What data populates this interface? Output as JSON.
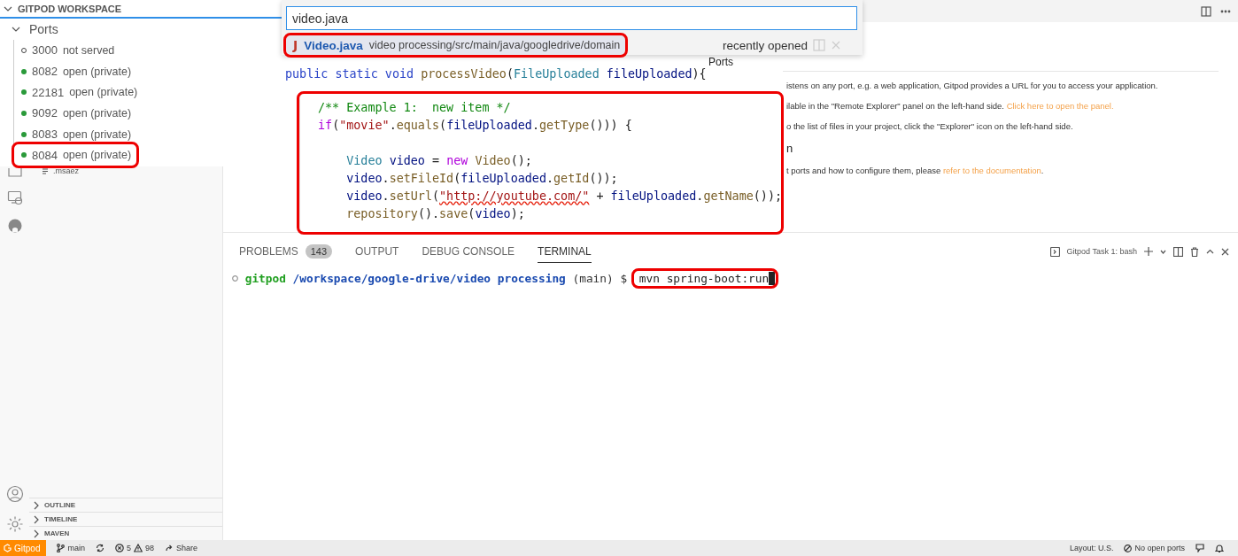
{
  "ports_panel": {
    "title": "GITPOD WORKSPACE",
    "section": "Ports",
    "expanded": true,
    "ports": [
      {
        "port": "3000",
        "status": "not served",
        "open": false,
        "highlighted": false
      },
      {
        "port": "8082",
        "status": "open (private)",
        "open": true,
        "highlighted": false
      },
      {
        "port": "22181",
        "status": "open (private)",
        "open": true,
        "highlighted": false
      },
      {
        "port": "9092",
        "status": "open (private)",
        "open": true,
        "highlighted": false
      },
      {
        "port": "8083",
        "status": "open (private)",
        "open": true,
        "highlighted": false
      },
      {
        "port": "8084",
        "status": "open (private)",
        "open": true,
        "highlighted": true
      }
    ]
  },
  "quick_open": {
    "value": "video.java",
    "results": [
      {
        "icon": "J",
        "name": "Video.java",
        "path": "video processing/src/main/java/googledrive/domain",
        "label": "recently opened",
        "selected": true,
        "highlighted": true
      }
    ]
  },
  "code_peek": {
    "signature": [
      {
        "kind": "keyword",
        "text": "public static void "
      },
      {
        "kind": "function",
        "text": "processVideo"
      },
      {
        "kind": "plain",
        "text": "("
      },
      {
        "kind": "type",
        "text": "FileUploaded "
      },
      {
        "kind": "variable",
        "text": "fileUploaded"
      },
      {
        "kind": "plain",
        "text": "){"
      }
    ],
    "block": {
      "highlighted": true,
      "groups": [
        {
          "lines": [
            [
              {
                "kind": "comment",
                "text": "/** Example 1:  new item */"
              }
            ],
            [
              {
                "kind": "control",
                "text": "if"
              },
              {
                "kind": "plain",
                "text": "("
              },
              {
                "kind": "string",
                "text": "\"movie\""
              },
              {
                "kind": "plain",
                "text": "."
              },
              {
                "kind": "function",
                "text": "equals"
              },
              {
                "kind": "plain",
                "text": "("
              },
              {
                "kind": "variable",
                "text": "fileUploaded"
              },
              {
                "kind": "plain",
                "text": "."
              },
              {
                "kind": "function",
                "text": "getType"
              },
              {
                "kind": "plain",
                "text": "())) {"
              }
            ]
          ]
        },
        {
          "lines": [
            [
              {
                "kind": "type",
                "text": "    Video "
              },
              {
                "kind": "variable",
                "text": "video"
              },
              {
                "kind": "plain",
                "text": " = "
              },
              {
                "kind": "control",
                "text": "new "
              },
              {
                "kind": "function",
                "text": "Video"
              },
              {
                "kind": "plain",
                "text": "();"
              }
            ],
            [
              {
                "kind": "variable",
                "text": "    video"
              },
              {
                "kind": "plain",
                "text": "."
              },
              {
                "kind": "function",
                "text": "setFileId"
              },
              {
                "kind": "plain",
                "text": "("
              },
              {
                "kind": "variable",
                "text": "fileUploaded"
              },
              {
                "kind": "plain",
                "text": "."
              },
              {
                "kind": "function",
                "text": "getId"
              },
              {
                "kind": "plain",
                "text": "());"
              }
            ],
            [
              {
                "kind": "variable",
                "text": "    video"
              },
              {
                "kind": "plain",
                "text": "."
              },
              {
                "kind": "function",
                "text": "setUrl"
              },
              {
                "kind": "plain",
                "text": "("
              },
              {
                "kind": "error_string",
                "text": "\"http://youtube.com/\""
              },
              {
                "kind": "plain",
                "text": " + "
              },
              {
                "kind": "variable",
                "text": "fileUploaded"
              },
              {
                "kind": "plain",
                "text": "."
              },
              {
                "kind": "function",
                "text": "getName"
              },
              {
                "kind": "plain",
                "text": "());"
              }
            ],
            [
              {
                "kind": "function",
                "text": "    repository"
              },
              {
                "kind": "plain",
                "text": "()."
              },
              {
                "kind": "function",
                "text": "save"
              },
              {
                "kind": "plain",
                "text": "("
              },
              {
                "kind": "variable",
                "text": "video"
              },
              {
                "kind": "plain",
                "text": ");"
              }
            ]
          ]
        }
      ]
    }
  },
  "editor": {
    "title": "Ports",
    "blocks": [
      {
        "kind": "paragraph",
        "text": "istens on any port, e.g. a web application, Gitpod provides a URL for you to access your application."
      },
      {
        "kind": "paragraph",
        "text": "ilable in the \"Remote Explorer\" panel on the left-hand side. ",
        "link": "Click here to open the panel."
      },
      {
        "kind": "paragraph",
        "text": "o the list of files in your project, click the \"Explorer\" icon on the left-hand side."
      },
      {
        "kind": "heading",
        "text": "n"
      },
      {
        "kind": "paragraph",
        "text": "t ports and how to configure them, please ",
        "link": "refer to the documentation",
        "after": "."
      }
    ]
  },
  "sidebar": {
    "file": ".msaez",
    "sections": [
      {
        "label": "OUTLINE",
        "expanded": false
      },
      {
        "label": "TIMELINE",
        "expanded": false
      },
      {
        "label": "MAVEN",
        "expanded": false
      }
    ]
  },
  "panel": {
    "tabs": [
      {
        "label": "PROBLEMS",
        "badge": "143",
        "selected": false
      },
      {
        "label": "OUTPUT",
        "selected": false
      },
      {
        "label": "DEBUG CONSOLE",
        "selected": false
      },
      {
        "label": "TERMINAL",
        "selected": true
      }
    ],
    "terminal_name": "Gitpod Task 1: bash",
    "terminal": {
      "user": "gitpod",
      "path": "/workspace/google-drive/video processing",
      "branch": "(main)",
      "symbol": "$",
      "command": "mvn spring-boot:run",
      "highlighted": true
    }
  },
  "status_bar": {
    "remote": "Gitpod",
    "branch": "main",
    "errors": "5",
    "warnings": "98",
    "share": "Share",
    "layout": "Layout: U.S.",
    "ports": "No open ports"
  }
}
